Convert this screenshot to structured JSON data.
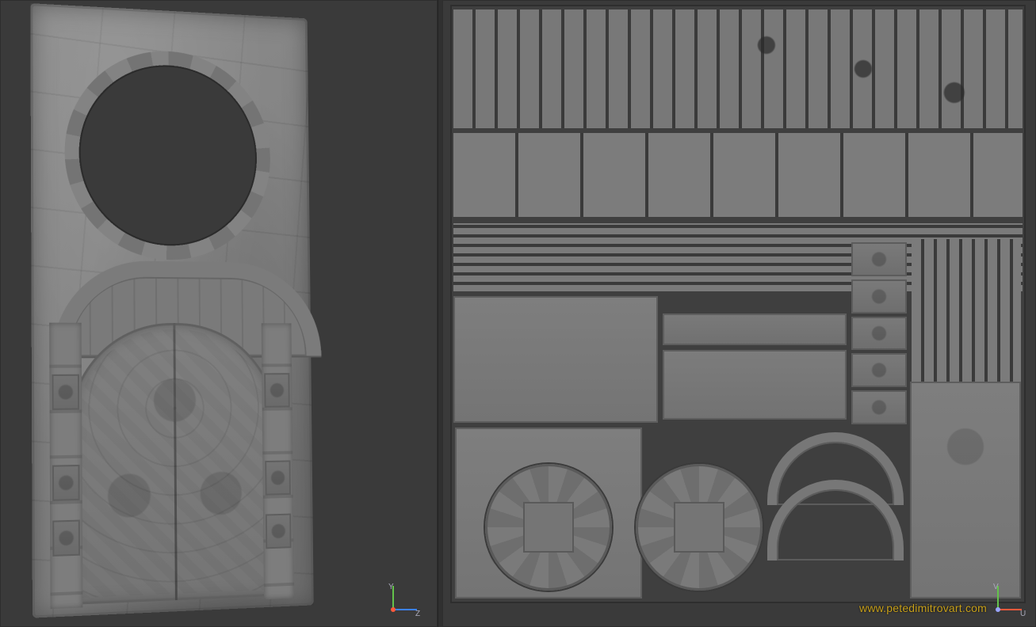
{
  "viewports": {
    "left": {
      "name": "perspective-viewport",
      "gizmo": {
        "axes": {
          "up": "Y",
          "right": "Z",
          "origin": ""
        },
        "colors": {
          "up": "#63c24b",
          "right": "#3c82ff",
          "origin": "#ff5a3c"
        }
      }
    },
    "right": {
      "name": "uv-viewport",
      "gizmo": {
        "axes": {
          "up": "V",
          "right": "U",
          "origin": ""
        },
        "colors": {
          "up": "#63c24b",
          "right": "#ff5a3c",
          "origin": "#9aa4ff"
        }
      }
    }
  },
  "watermark": {
    "text": "www.petedimitrovart.com"
  }
}
